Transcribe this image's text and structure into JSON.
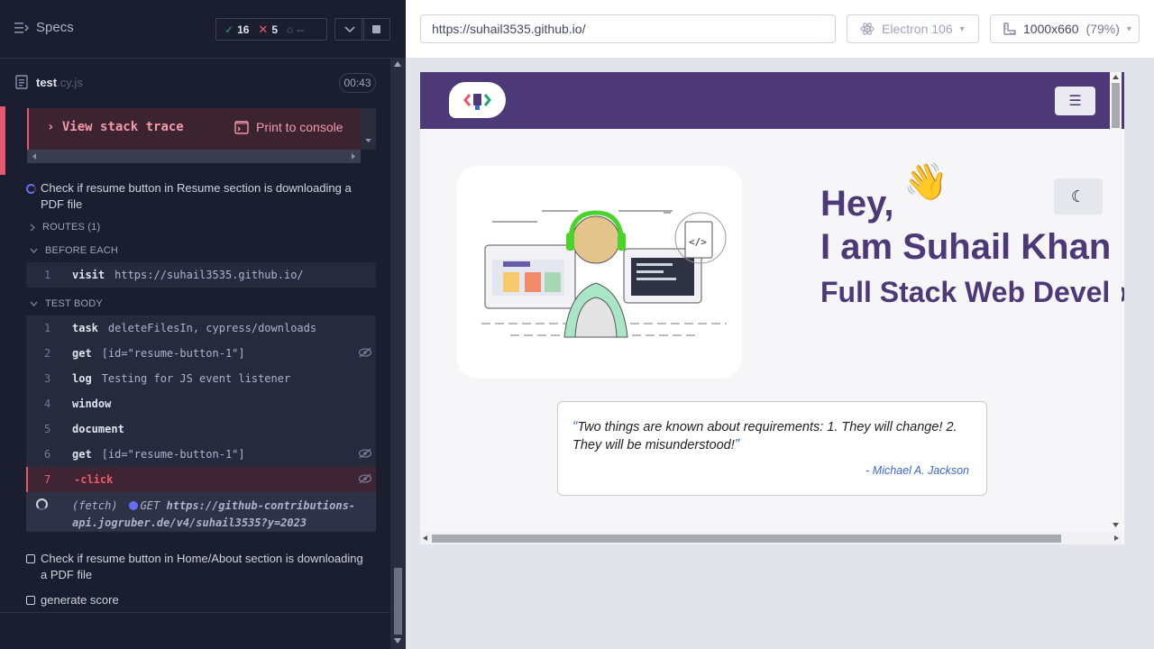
{
  "reporter": {
    "header": {
      "specs_label": "Specs",
      "passed": "16",
      "failed": "5",
      "pending": "--"
    },
    "file": {
      "name": "test",
      "ext": ".cy.js",
      "duration": "00:43"
    },
    "error": {
      "stack_trace": "View stack trace",
      "print_console": "Print to console"
    },
    "running_test": {
      "title": "Check if resume button in Resume section is downloading a PDF file"
    },
    "routes": "ROUTES (1)",
    "before_each": {
      "label": "BEFORE EACH",
      "commands": [
        {
          "num": "1",
          "name": "visit",
          "msg": "https://suhail3535.github.io/"
        }
      ]
    },
    "test_body": {
      "label": "TEST BODY",
      "commands": [
        {
          "num": "1",
          "name": "task",
          "msg": "deleteFilesIn, cypress/downloads"
        },
        {
          "num": "2",
          "name": "get",
          "msg": "[id=\"resume-button-1\"]"
        },
        {
          "num": "3",
          "name": "log",
          "msg": "Testing for JS event listener"
        },
        {
          "num": "4",
          "name": "window",
          "msg": ""
        },
        {
          "num": "5",
          "name": "document",
          "msg": ""
        },
        {
          "num": "6",
          "name": "get",
          "msg": "[id=\"resume-button-1\"]"
        },
        {
          "num": "7",
          "name": "-click",
          "msg": ""
        }
      ],
      "fetch": {
        "label": "(fetch)",
        "method": "GET",
        "url_line1": "https://github-contributions-",
        "url_line2": "api.jogruber.de/v4/suhail3535?y=2023"
      }
    },
    "pending_tests": [
      "Check if resume button in Home/About section is downloading a PDF file",
      "generate score"
    ]
  },
  "aut": {
    "url": "https://suhail3535.github.io/",
    "browser": "Electron 106",
    "viewport": "1000x660",
    "scale": "(79%)",
    "site": {
      "hero_line1": "Hey,",
      "hero_wave": "👋",
      "hero_line2": "I am Suhail Khan",
      "hero_line3": "Full Stack Web Develo",
      "quote": "Two things are known about requirements: 1. They will change! 2. They will be misunderstood!",
      "quote_author": "- Michael A. Jackson"
    }
  },
  "colors": {
    "reporter_bg": "#1b1e2e",
    "fail_red": "#e45770",
    "pass_green": "#1fa971",
    "site_purple": "#4d3878",
    "quote_blue": "#3867d6"
  }
}
